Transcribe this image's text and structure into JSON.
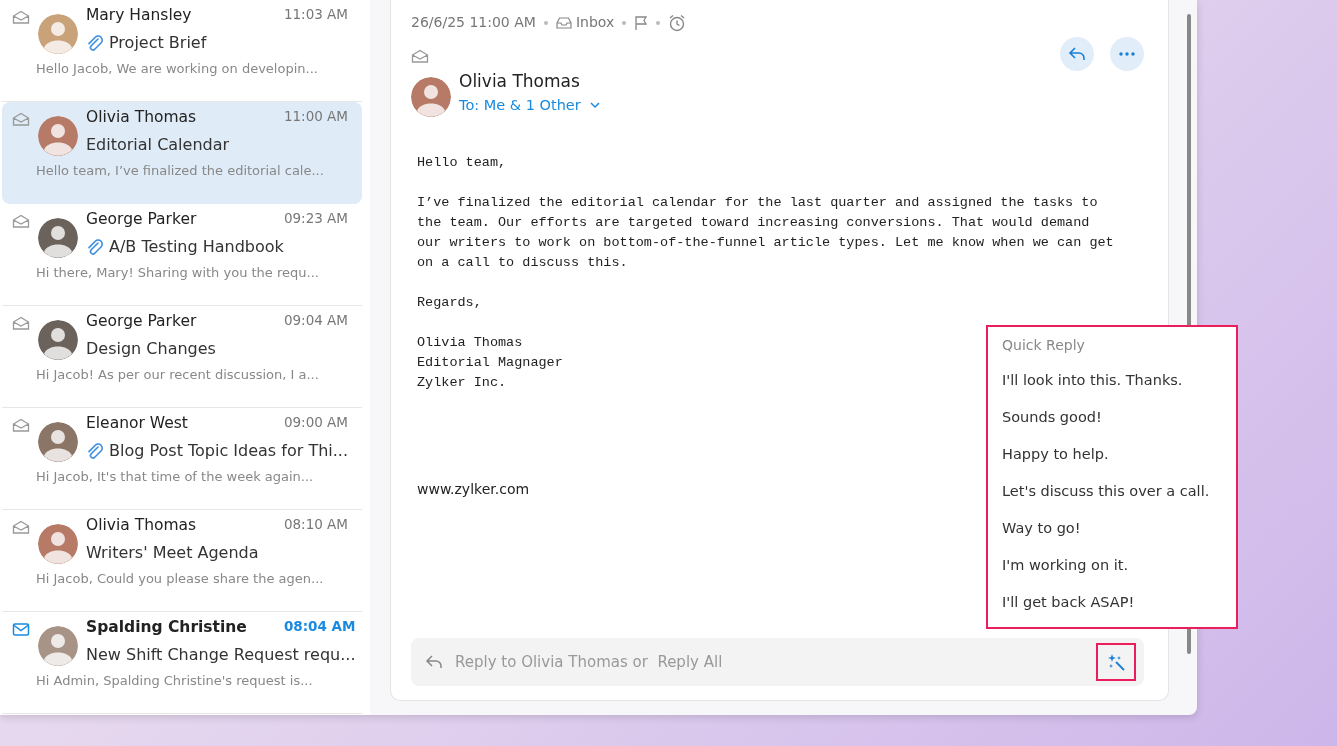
{
  "mail_list": [
    {
      "sender": "Mary Hansley",
      "time": "11:03 AM",
      "subject": "Project Brief",
      "preview": "Hello Jacob, We are working on developin...",
      "attachment": true,
      "unread": false,
      "selected": false
    },
    {
      "sender": "Olivia Thomas",
      "time": "11:00 AM",
      "subject": "Editorial Calendar",
      "preview": "Hello team, I’ve finalized the editorial cale...",
      "attachment": false,
      "unread": false,
      "selected": true
    },
    {
      "sender": "George Parker",
      "time": "09:23 AM",
      "subject": "A/B Testing Handbook",
      "preview": "Hi there, Mary! Sharing with you the requ...",
      "attachment": true,
      "unread": false,
      "selected": false
    },
    {
      "sender": "George Parker",
      "time": "09:04 AM",
      "subject": "Design Changes",
      "preview": "Hi Jacob! As per our recent discussion, I a...",
      "attachment": false,
      "unread": false,
      "selected": false
    },
    {
      "sender": "Eleanor West",
      "time": "09:00 AM",
      "subject": "Blog Post Topic Ideas for Thi...",
      "preview": "Hi Jacob, It's that time of the week again...",
      "attachment": true,
      "unread": false,
      "selected": false
    },
    {
      "sender": "Olivia Thomas",
      "time": "08:10 AM",
      "subject": "Writers' Meet Agenda",
      "preview": "Hi Jacob, Could you please share the agen...",
      "attachment": false,
      "unread": false,
      "selected": false
    },
    {
      "sender": "Spalding Christine",
      "time": "08:04 AM",
      "subject": "New Shift Change Request requ...",
      "preview": "Hi Admin, Spalding Christine's request is...",
      "attachment": false,
      "unread": true,
      "selected": false
    }
  ],
  "message": {
    "date": "26/6/25 11:00 AM",
    "folder": "Inbox",
    "sender": "Olivia Thomas",
    "recipients": "To: Me & 1 Other",
    "body": [
      "Hello team,",
      "I’ve finalized the editorial calendar for the last quarter and assigned the tasks to the team. Our efforts are targeted toward increasing conversions. That would demand our writers to work on bottom-of-the-funnel article types. Let me know when we can get on a call to discuss this.",
      "Regards,",
      "Olivia Thomas\nEditorial Magnager\nZylker Inc."
    ],
    "website": "www.zylker.com"
  },
  "quick_reply": {
    "title": "Quick Reply",
    "options": [
      "I'll look into this. Thanks.",
      "Sounds good!",
      "Happy to help.",
      "Let's discuss this over a call.",
      "Way to go!",
      "I'm working on it.",
      "I'll get back ASAP!"
    ]
  },
  "reply_bar": {
    "placeholder": "Reply to Olivia Thomas or  Reply All"
  }
}
